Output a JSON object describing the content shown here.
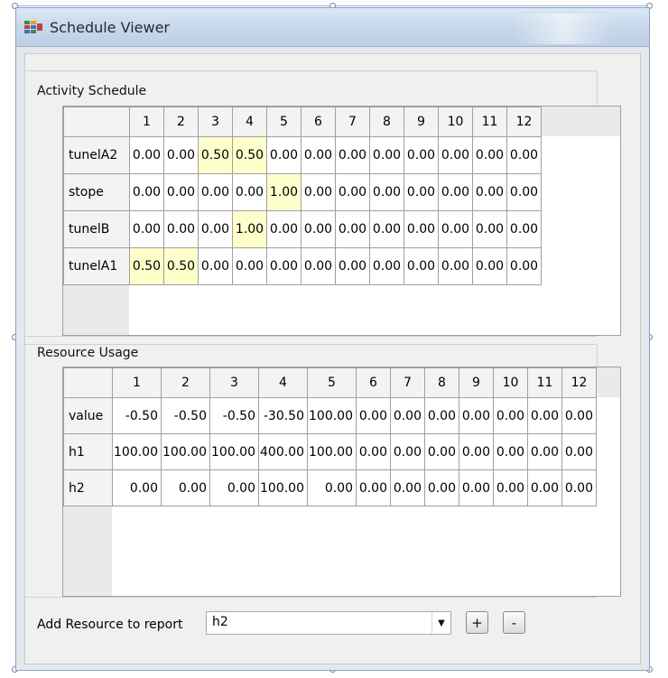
{
  "window": {
    "title": "Schedule Viewer",
    "icon": "app-grid-icon"
  },
  "activity": {
    "label": "Activity Schedule",
    "columns": [
      "1",
      "2",
      "3",
      "4",
      "5",
      "6",
      "7",
      "8",
      "9",
      "10",
      "11",
      "12"
    ],
    "rows": [
      {
        "name": "tunelA2",
        "values": [
          "0.00",
          "0.00",
          "0.50",
          "0.50",
          "0.00",
          "0.00",
          "0.00",
          "0.00",
          "0.00",
          "0.00",
          "0.00",
          "0.00"
        ],
        "highlight": [
          2,
          3
        ]
      },
      {
        "name": "stope",
        "values": [
          "0.00",
          "0.00",
          "0.00",
          "0.00",
          "1.00",
          "0.00",
          "0.00",
          "0.00",
          "0.00",
          "0.00",
          "0.00",
          "0.00"
        ],
        "highlight": [
          4
        ]
      },
      {
        "name": "tunelB",
        "values": [
          "0.00",
          "0.00",
          "0.00",
          "1.00",
          "0.00",
          "0.00",
          "0.00",
          "0.00",
          "0.00",
          "0.00",
          "0.00",
          "0.00"
        ],
        "highlight": [
          3
        ]
      },
      {
        "name": "tunelA1",
        "values": [
          "0.50",
          "0.50",
          "0.00",
          "0.00",
          "0.00",
          "0.00",
          "0.00",
          "0.00",
          "0.00",
          "0.00",
          "0.00",
          "0.00"
        ],
        "highlight": [
          0,
          1
        ]
      }
    ],
    "highlight_color": "#ffffcb"
  },
  "resource": {
    "label": "Resource Usage",
    "columns": [
      "1",
      "2",
      "3",
      "4",
      "5",
      "6",
      "7",
      "8",
      "9",
      "10",
      "11",
      "12"
    ],
    "rows": [
      {
        "name": "value",
        "values": [
          "-0.50",
          "-0.50",
          "-0.50",
          "-30.50",
          "100.00",
          "0.00",
          "0.00",
          "0.00",
          "0.00",
          "0.00",
          "0.00",
          "0.00"
        ]
      },
      {
        "name": "h1",
        "values": [
          "100.00",
          "100.00",
          "100.00",
          "400.00",
          "100.00",
          "0.00",
          "0.00",
          "0.00",
          "0.00",
          "0.00",
          "0.00",
          "0.00"
        ]
      },
      {
        "name": "h2",
        "values": [
          "0.00",
          "0.00",
          "0.00",
          "100.00",
          "0.00",
          "0.00",
          "0.00",
          "0.00",
          "0.00",
          "0.00",
          "0.00",
          "0.00"
        ]
      }
    ]
  },
  "footer": {
    "add_label": "Add Resource to report",
    "selected_resource": "h2",
    "add_button": "+",
    "remove_button": "-"
  }
}
